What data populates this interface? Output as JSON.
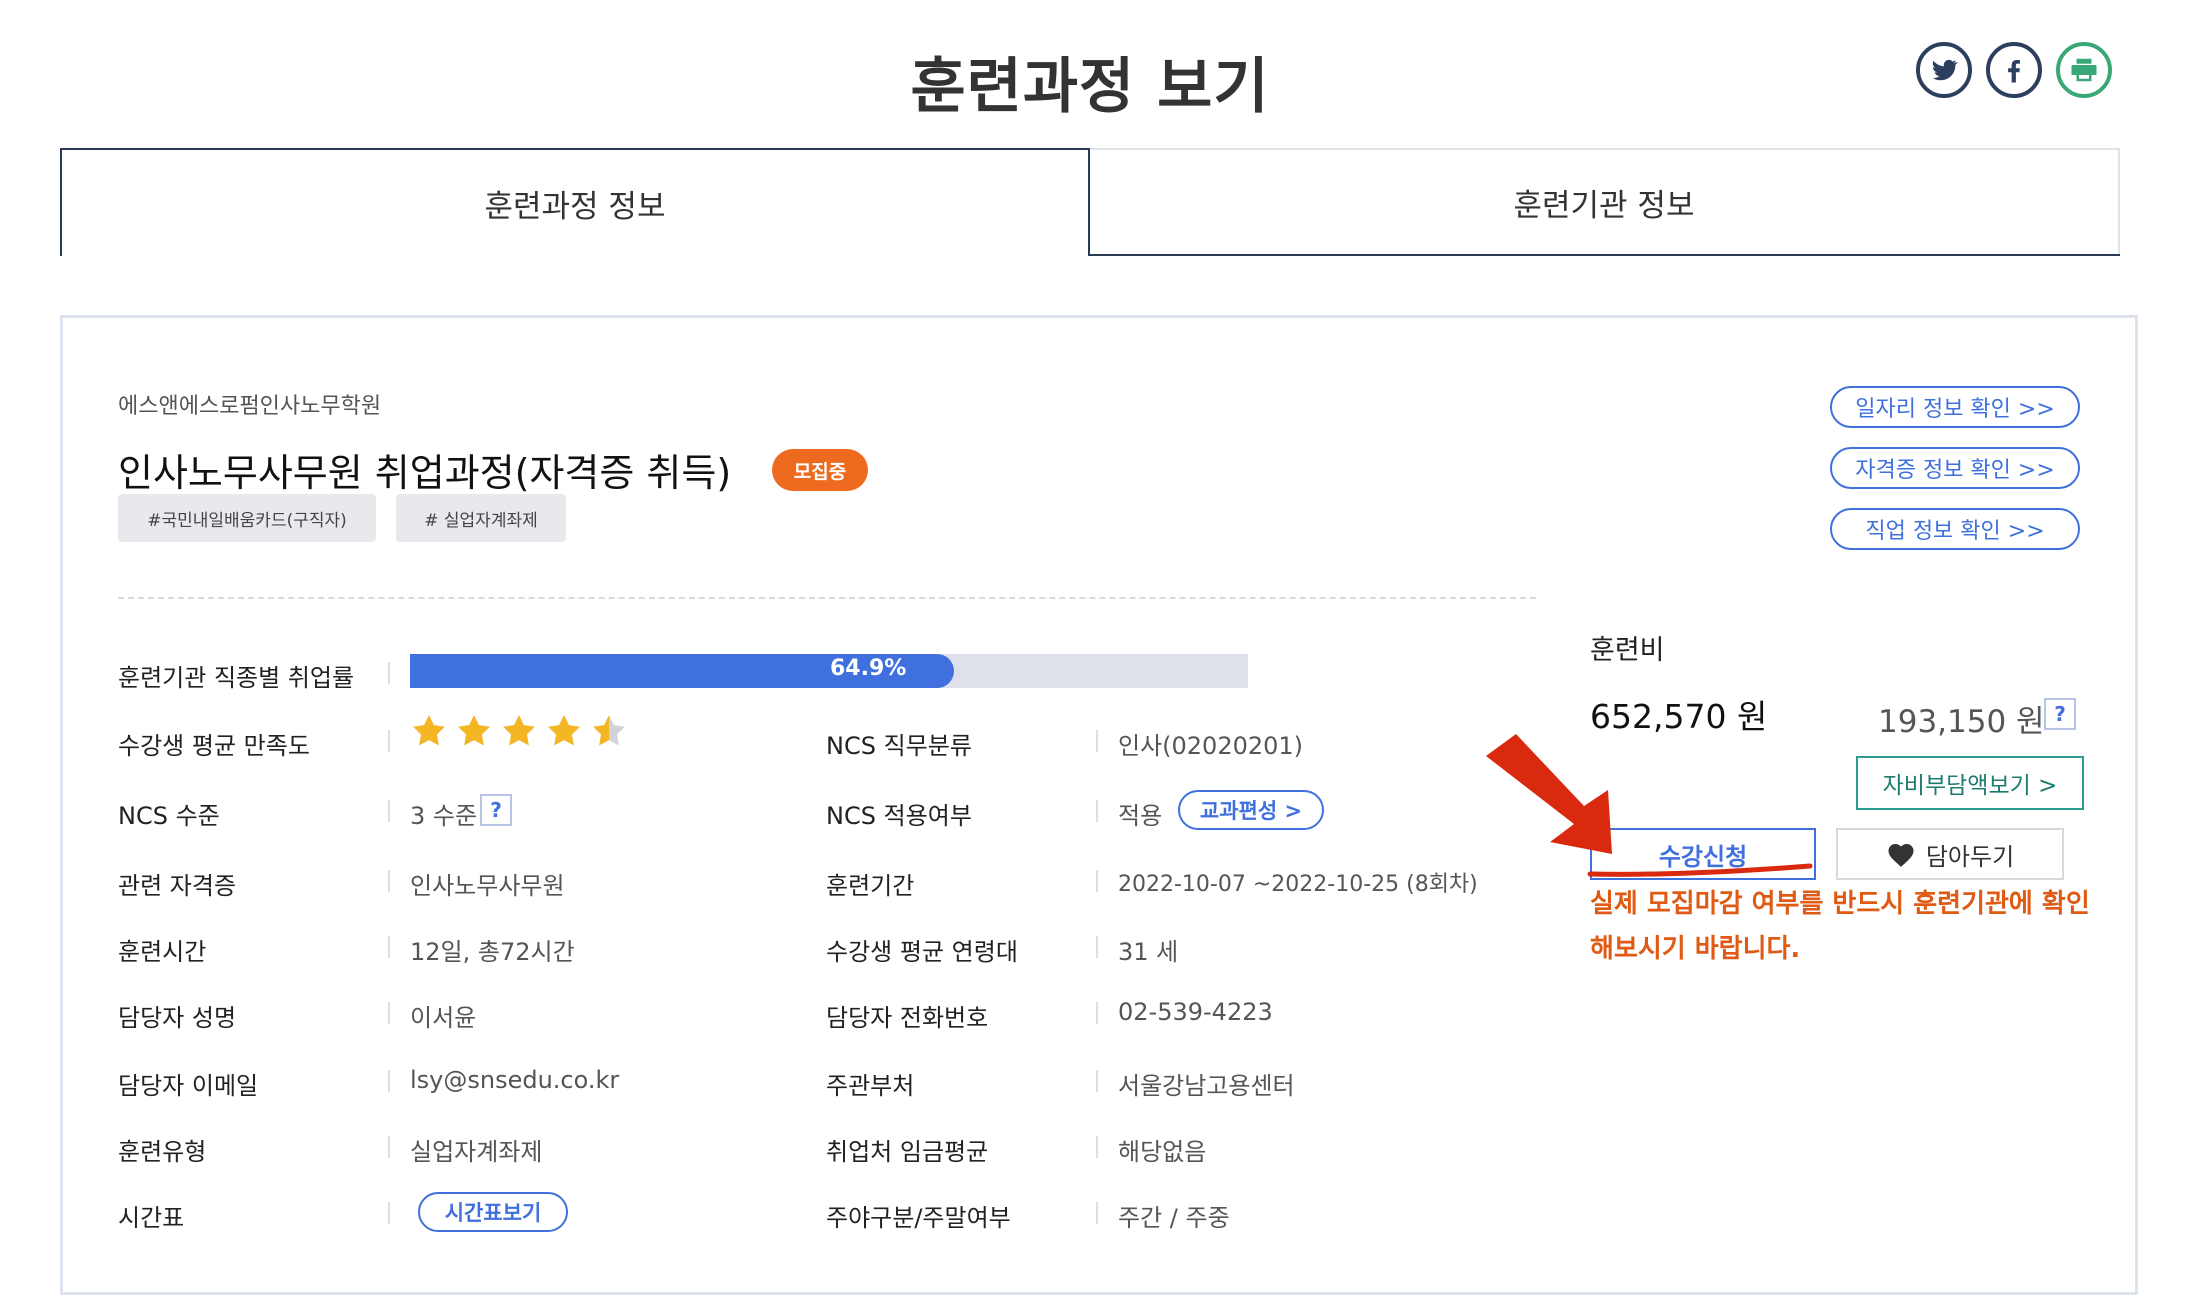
{
  "page": {
    "title": "훈련과정 보기"
  },
  "share": {
    "twitter_icon": "twitter-icon",
    "facebook_icon": "facebook-icon",
    "print_icon": "print-icon"
  },
  "tabs": [
    {
      "label": "훈련과정 정보",
      "active": true
    },
    {
      "label": "훈련기관 정보",
      "active": false
    }
  ],
  "course": {
    "institution": "에스앤에스로펌인사노무학원",
    "title": "인사노무사무원 취업과정(자격증 취득)",
    "status_badge": "모집중",
    "tags": [
      "#국민내일배움카드(구직자)",
      "# 실업자계좌제"
    ]
  },
  "links": {
    "job_info": "일자리 정보 확인 >>",
    "cert_info": "자격증 정보 확인 >>",
    "occupation_info": "직업 정보 확인 >>"
  },
  "details": {
    "employment_rate_label": "훈련기관 직종별 취업률",
    "employment_rate_value": "64.9%",
    "employment_rate_fraction": 0.649,
    "satisfaction_label": "수강생 평균 만족도",
    "satisfaction_stars": 4.5,
    "ncs_class_label": "NCS 직무분류",
    "ncs_class_value": "인사(02020201)",
    "ncs_level_label": "NCS 수준",
    "ncs_level_value": "3 수준",
    "ncs_apply_label": "NCS 적용여부",
    "ncs_apply_value": "적용",
    "curriculum_button": "교과편성 >",
    "cert_label": "관련 자격증",
    "cert_value": "인사노무사무원",
    "period_label": "훈련기간",
    "period_value": "2022-10-07 ~2022-10-25 (8회차)",
    "hours_label": "훈련시간",
    "hours_value": "12일, 총72시간",
    "age_label": "수강생 평균 연령대",
    "age_value": "31 세",
    "manager_label": "담당자 성명",
    "manager_value": "이서윤",
    "phone_label": "담당자 전화번호",
    "phone_value": "02-539-4223",
    "email_label": "담당자 이메일",
    "email_value": "lsy@snsedu.co.kr",
    "agency_label": "주관부처",
    "agency_value": "서울강남고용센터",
    "type_label": "훈련유형",
    "type_value": "실업자계좌제",
    "wage_label": "취업처 임금평균",
    "wage_value": "해당없음",
    "timetable_label": "시간표",
    "timetable_button": "시간표보기",
    "daynight_label": "주야구분/주말여부",
    "daynight_value": "주간 / 주중",
    "help_mark": "?"
  },
  "fee": {
    "label": "훈련비",
    "total": "652,570 원",
    "self_pay": "193,150 원",
    "self_pay_button": "자비부담액보기 >",
    "help_mark": "?"
  },
  "actions": {
    "apply_button": "수강신청",
    "save_button": "담아두기"
  },
  "notice": "실제 모집마감 여부를 반드시 훈련기관에 확인해보시기 바랍니다.",
  "colors": {
    "accent": "#3f70de",
    "badge": "#ee6a1e",
    "notice": "#e05a14",
    "annotation": "#d9290f"
  }
}
